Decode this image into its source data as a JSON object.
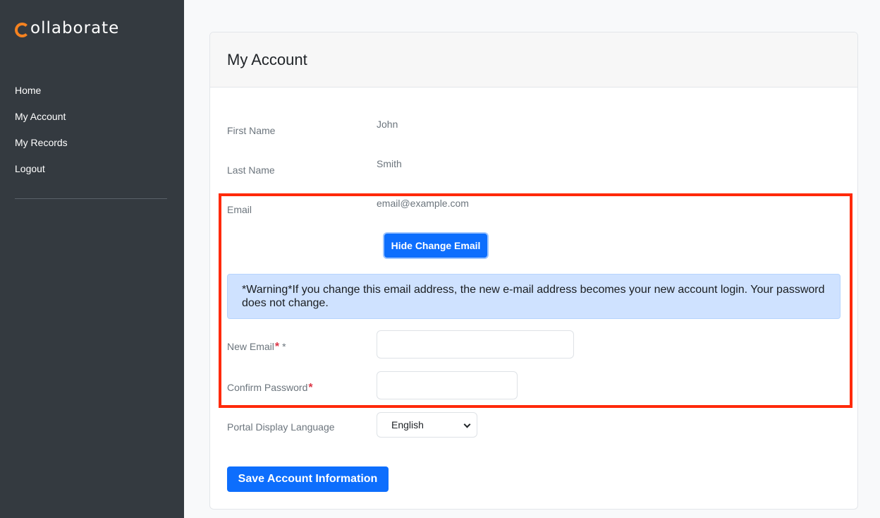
{
  "app": {
    "logo_text": "ollaborate"
  },
  "sidebar": {
    "items": [
      {
        "label": "Home"
      },
      {
        "label": "My Account"
      },
      {
        "label": "My Records"
      },
      {
        "label": "Logout"
      }
    ]
  },
  "page": {
    "title": "My Account"
  },
  "fields": {
    "first_name": {
      "label": "First Name",
      "value": "John"
    },
    "last_name": {
      "label": "Last Name",
      "value": "Smith"
    },
    "email": {
      "label": "Email",
      "value": "email@example.com"
    },
    "new_email": {
      "label": "New Email",
      "required_mark": "*",
      "extra_mark": "*",
      "value": ""
    },
    "confirm_password": {
      "label": "Confirm Password",
      "required_mark": "*",
      "value": ""
    },
    "language": {
      "label": "Portal Display Language",
      "selected": "English"
    }
  },
  "buttons": {
    "hide_change_email": "Hide Change Email",
    "save": "Save Account Information"
  },
  "alert": {
    "text": "*Warning*If you change this email address, the new e-mail address becomes your new account login. Your password does not change."
  },
  "colors": {
    "sidebar_bg": "#343a40",
    "accent": "#0d6efd",
    "logo_accent": "#f58220",
    "highlight_border": "#ff2a0a",
    "alert_bg": "#cfe2ff",
    "required": "#dc3545"
  }
}
